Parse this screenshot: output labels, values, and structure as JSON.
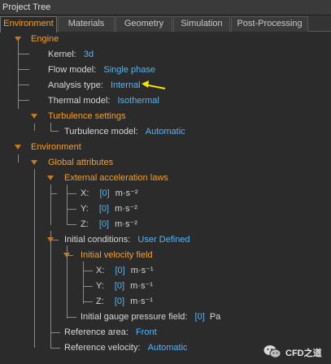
{
  "window": {
    "title": "Project Tree"
  },
  "tabs": [
    {
      "label": "Environment",
      "active": true
    },
    {
      "label": "Materials"
    },
    {
      "label": "Geometry"
    },
    {
      "label": "Simulation"
    },
    {
      "label": "Post-Processing"
    }
  ],
  "tree": {
    "engine": {
      "label": "Engine",
      "kernel": {
        "label": "Kernel:",
        "value": "3d"
      },
      "flow_model": {
        "label": "Flow model:",
        "value": "Single phase"
      },
      "analysis_type": {
        "label": "Analysis type:",
        "value": "Internal"
      },
      "thermal_model": {
        "label": "Thermal model:",
        "value": "Isothermal"
      },
      "turbulence_settings": {
        "label": "Turbulence settings",
        "turbulence_model": {
          "label": "Turbulence model:",
          "value": "Automatic"
        }
      }
    },
    "environment": {
      "label": "Environment",
      "global_attributes": {
        "label": "Global attributes",
        "external_acceleration": {
          "label": "External acceleration laws",
          "x": {
            "label": "X:",
            "value": "[0]",
            "unit": "m·s⁻²"
          },
          "y": {
            "label": "Y:",
            "value": "[0]",
            "unit": "m·s⁻²"
          },
          "z": {
            "label": "Z:",
            "value": "[0]",
            "unit": "m·s⁻²"
          }
        },
        "initial_conditions": {
          "label": "Initial conditions:",
          "value": "User Defined",
          "initial_velocity": {
            "label": "Initial velocity field",
            "x": {
              "label": "X:",
              "value": "[0]",
              "unit": "m·s⁻¹"
            },
            "y": {
              "label": "Y:",
              "value": "[0]",
              "unit": "m·s⁻¹"
            },
            "z": {
              "label": "Z:",
              "value": "[0]",
              "unit": "m·s⁻¹"
            }
          },
          "initial_gauge_pressure": {
            "label": "Initial gauge pressure field:",
            "value": "[0]",
            "unit": "Pa"
          }
        },
        "reference_area": {
          "label": "Reference area:",
          "value": "Front"
        },
        "reference_velocity": {
          "label": "Reference velocity:",
          "value": "Automatic"
        }
      }
    }
  },
  "annotation": {
    "arrow_color": "#f2e600"
  },
  "watermark": {
    "text": "CFD之道",
    "logo": "wechat-icon"
  },
  "colors": {
    "header": "#f0a030",
    "value": "#59b4f0",
    "label": "#d6d6d6",
    "background": "#2b2b2b"
  }
}
